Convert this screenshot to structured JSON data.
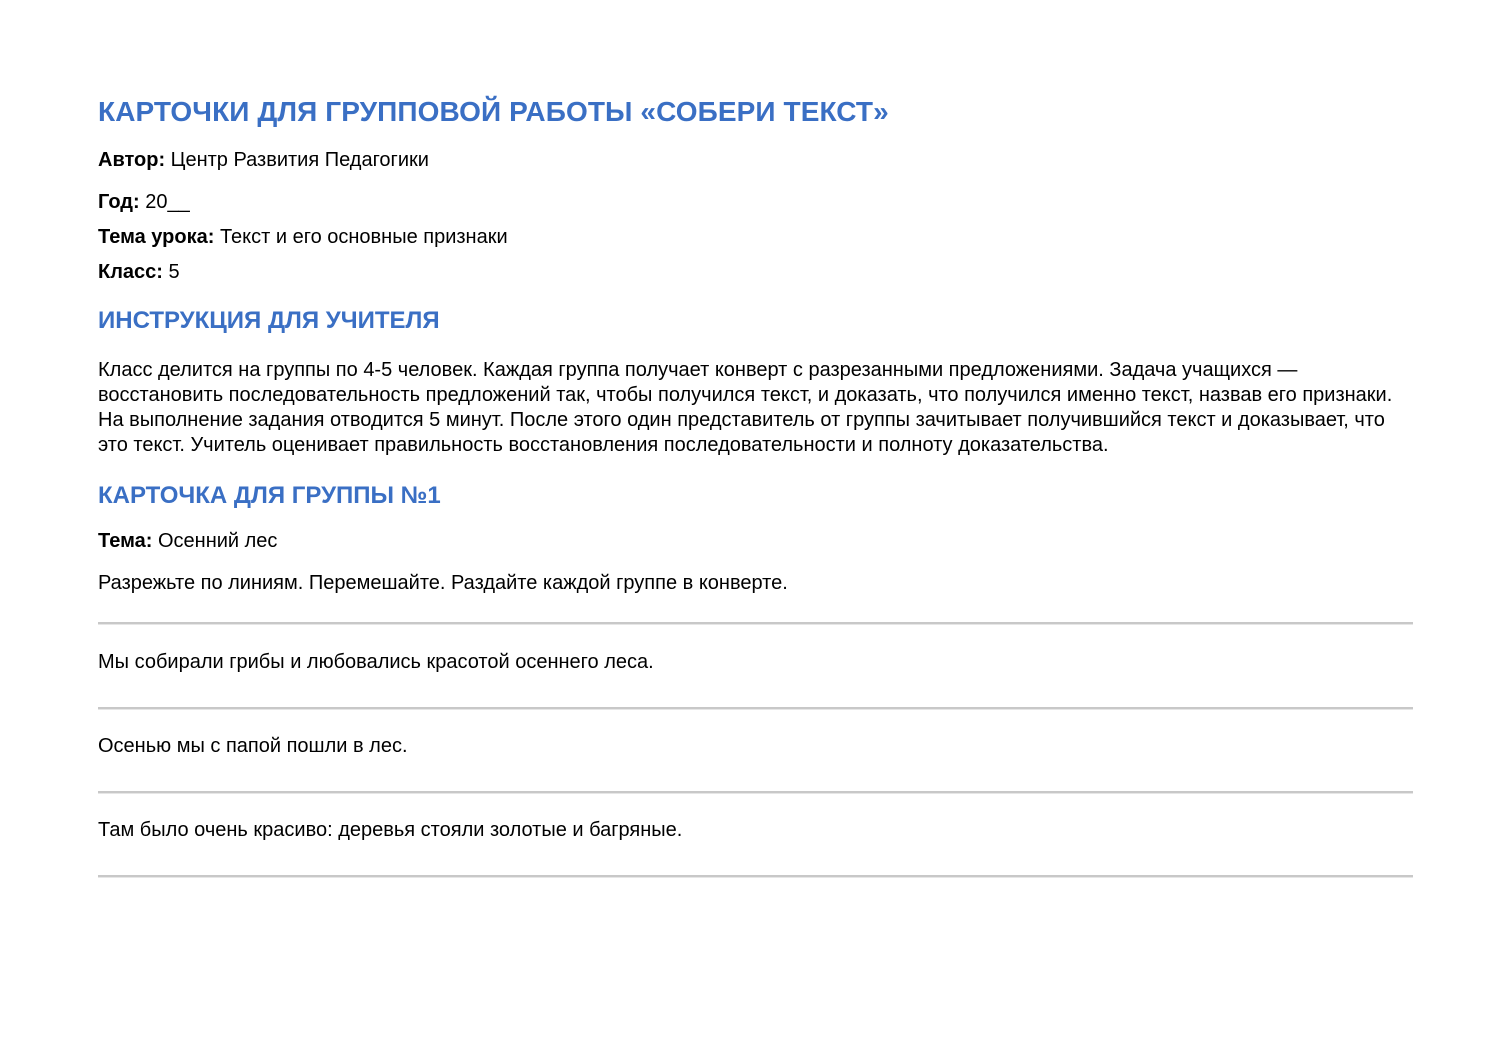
{
  "document": {
    "title": "КАРТОЧКИ ДЛЯ ГРУППОВОЙ РАБОТЫ «СОБЕРИ ТЕКСТ»",
    "meta": {
      "author_label": "Автор:",
      "author_value": " Центр Развития Педагогики",
      "year_label": "Год:",
      "year_value": " 20__",
      "topic_label": "Тема урока:",
      "topic_value": " Текст и его основные признаки",
      "grade_label": "Класс:",
      "grade_value": " 5"
    },
    "instruction": {
      "heading": "ИНСТРУКЦИЯ ДЛЯ УЧИТЕЛЯ",
      "text": "Класс делится на группы по 4-5 человек. Каждая группа получает конверт с разрезанными предложениями. Задача учащихся — восстановить последовательность предложений так, чтобы получился текст, и доказать, что получился именно текст, назвав его признаки. На выполнение задания отводится 5 минут. После этого один представитель от группы зачитывает получившийся текст и доказывает, что это текст. Учитель оценивает правильность восстановления последовательности и полноту доказательства."
    },
    "card": {
      "heading": "КАРТОЧКА ДЛЯ ГРУППЫ №1",
      "theme_label": "Тема:",
      "theme_value": " Осенний лес",
      "cut_instruction": "Разрежьте по линиям. Перемешайте. Раздайте каждой группе в конверте.",
      "strips": [
        "Мы собирали грибы и любовались красотой осеннего леса.",
        "Осенью мы с папой пошли в лес.",
        "Там было очень красиво: деревья стояли золотые и багряные."
      ]
    },
    "colors": {
      "heading": "#3a6fc4",
      "cut_line": "#c8c8c8"
    }
  }
}
